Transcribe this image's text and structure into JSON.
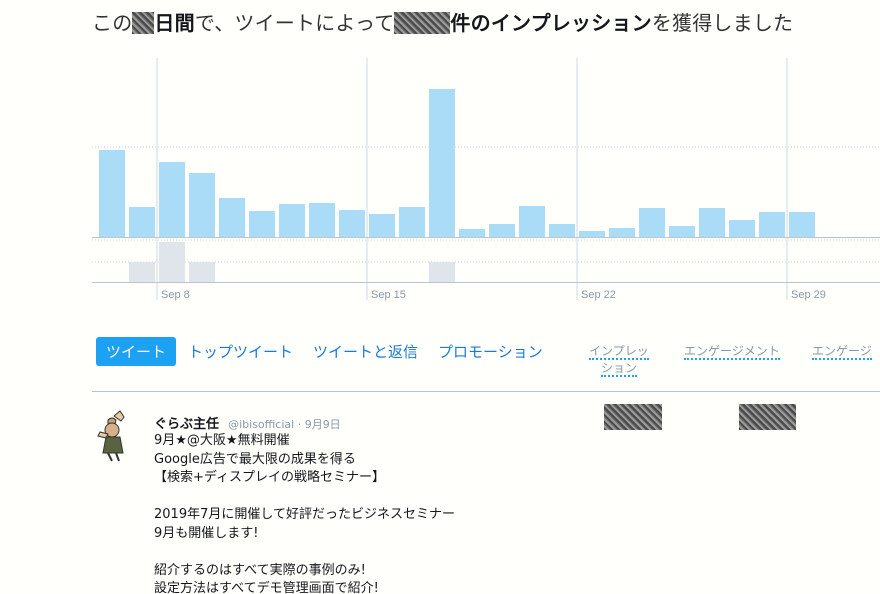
{
  "headline": {
    "prefix": "この",
    "days_label": "日間",
    "middle": "で、ツイートによって",
    "suffix_bold": "件のインプレッション",
    "suffix": "を獲得しました"
  },
  "chart_data": {
    "type": "bar",
    "x_tick_labels": [
      "Sep 8",
      "Sep 15",
      "Sep 22",
      "Sep 29"
    ],
    "impressions": [
      87,
      30,
      75,
      64,
      39,
      26,
      33,
      34,
      27,
      23,
      30,
      148,
      8,
      13,
      31,
      13,
      6,
      9,
      29,
      11,
      29,
      17,
      25,
      25
    ],
    "engagements": [
      0,
      1,
      2,
      1,
      0,
      0,
      0,
      0,
      0,
      0,
      0,
      1,
      0,
      0,
      0,
      0,
      0,
      0,
      0,
      0,
      0,
      0,
      0,
      0
    ],
    "colors": {
      "impressions": "#abdcf7",
      "engagements": "#dfe5ea"
    }
  },
  "tabs": [
    "ツイート",
    "トップツイート",
    "ツイートと返信",
    "プロモーション"
  ],
  "columns": {
    "impressions": "インプレッション",
    "engagements": "エンゲージメント",
    "engagement_rate": "エンゲージ"
  },
  "tweet": {
    "name": "ぐらぶ主任",
    "handle_date": "@ibisofficial · 9月9日",
    "text": "9月★@大阪★無料開催\nGoogle広告で最大限の成果を得る\n【検索+ディスプレイの戦略セミナー】\n\n2019年7月に開催して好評だったビジネスセミナー\n9月も開催します!\n\n紹介するのはすべて実際の事例のみ!\n設定方法はすべてデモ管理画面で紹介!"
  }
}
